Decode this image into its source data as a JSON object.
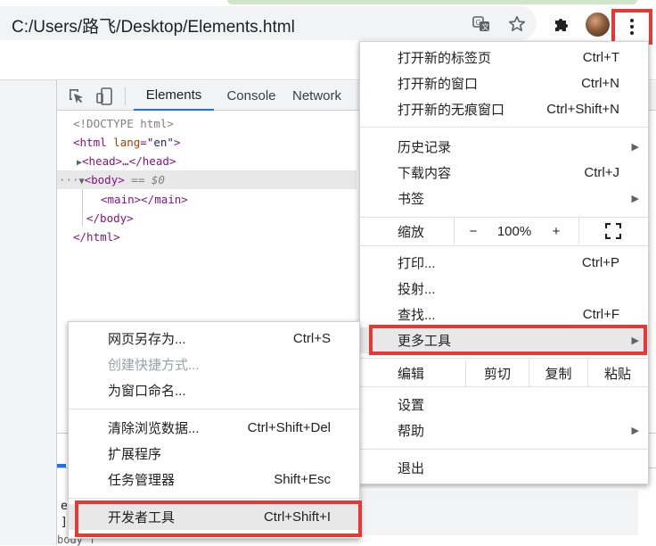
{
  "address_bar": {
    "url": "C:/Users/路飞/Desktop/Elements.html"
  },
  "icons": {
    "translate": "translate-icon",
    "star": "star-icon",
    "extensions": "puzzle-icon",
    "menu": "vertical-dots-icon",
    "inspect": "inspect-icon",
    "device": "device-toolbar-icon"
  },
  "devtools": {
    "tabs": [
      "Elements",
      "Console",
      "Network"
    ],
    "code": {
      "doctype": "<!DOCTYPE html>",
      "html_open_tag": "<html",
      "html_attr": "lang",
      "html_attr_val": "\"en\"",
      "html_close_bracket": ">",
      "head_collapsed": "<head>…</head>",
      "body_dots": "···",
      "body_tag": "<body>",
      "body_eq": "== $0",
      "main": "<main></main>",
      "body_close": "</body>",
      "html_close": "</html>"
    },
    "lower_text_1": "e",
    "lower_text_2": "]",
    "bottom_text": "body  f"
  },
  "main_menu": {
    "new_tab": {
      "label": "打开新的标签页",
      "shortcut": "Ctrl+T"
    },
    "new_window": {
      "label": "打开新的窗口",
      "shortcut": "Ctrl+N"
    },
    "incognito": {
      "label": "打开新的无痕窗口",
      "shortcut": "Ctrl+Shift+N"
    },
    "history": {
      "label": "历史记录"
    },
    "downloads": {
      "label": "下载内容",
      "shortcut": "Ctrl+J"
    },
    "bookmarks": {
      "label": "书签"
    },
    "zoom": {
      "label": "缩放",
      "minus": "−",
      "level": "100%",
      "plus": "+"
    },
    "print": {
      "label": "打印...",
      "shortcut": "Ctrl+P"
    },
    "cast": {
      "label": "投射..."
    },
    "find": {
      "label": "查找...",
      "shortcut": "Ctrl+F"
    },
    "more_tools": {
      "label": "更多工具"
    },
    "edit": {
      "label": "编辑",
      "cut": "剪切",
      "copy": "复制",
      "paste": "粘贴"
    },
    "settings": {
      "label": "设置"
    },
    "help": {
      "label": "帮助"
    },
    "exit": {
      "label": "退出"
    }
  },
  "sub_menu": {
    "save_page": {
      "label": "网页另存为...",
      "shortcut": "Ctrl+S"
    },
    "create_shortcut": {
      "label": "创建快捷方式..."
    },
    "name_window": {
      "label": "为窗口命名..."
    },
    "clear_data": {
      "label": "清除浏览数据...",
      "shortcut": "Ctrl+Shift+Del"
    },
    "extensions": {
      "label": "扩展程序"
    },
    "task_manager": {
      "label": "任务管理器",
      "shortcut": "Shift+Esc"
    },
    "developer_tools": {
      "label": "开发者工具",
      "shortcut": "Ctrl+Shift+I"
    }
  },
  "colors": {
    "highlight_border": "#e53935",
    "accent": "#1a73e8"
  }
}
